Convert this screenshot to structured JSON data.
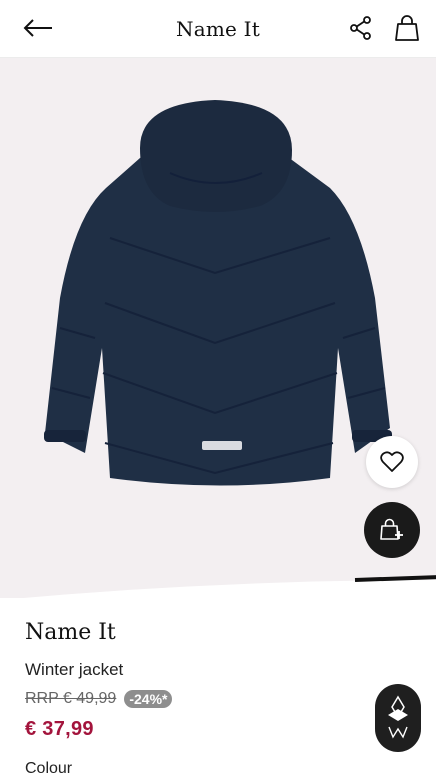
{
  "header": {
    "title": "Name It"
  },
  "product": {
    "brand": "Name It",
    "name": "Winter jacket",
    "rrp": "RRP € 49,99",
    "discount": "-24%*",
    "price": "€ 37,99",
    "next_section_label": "Colour"
  },
  "colors": {
    "price": "#a3143c",
    "jacket": "#1f2f45",
    "image_bg": "#f3eff1"
  },
  "icons": {
    "back": "arrow-left-icon",
    "share": "share-icon",
    "bag": "shopping-bag-icon",
    "favorite": "heart-icon",
    "add_to_cart": "bag-plus-icon",
    "assistant": "assistant-logo-icon"
  }
}
